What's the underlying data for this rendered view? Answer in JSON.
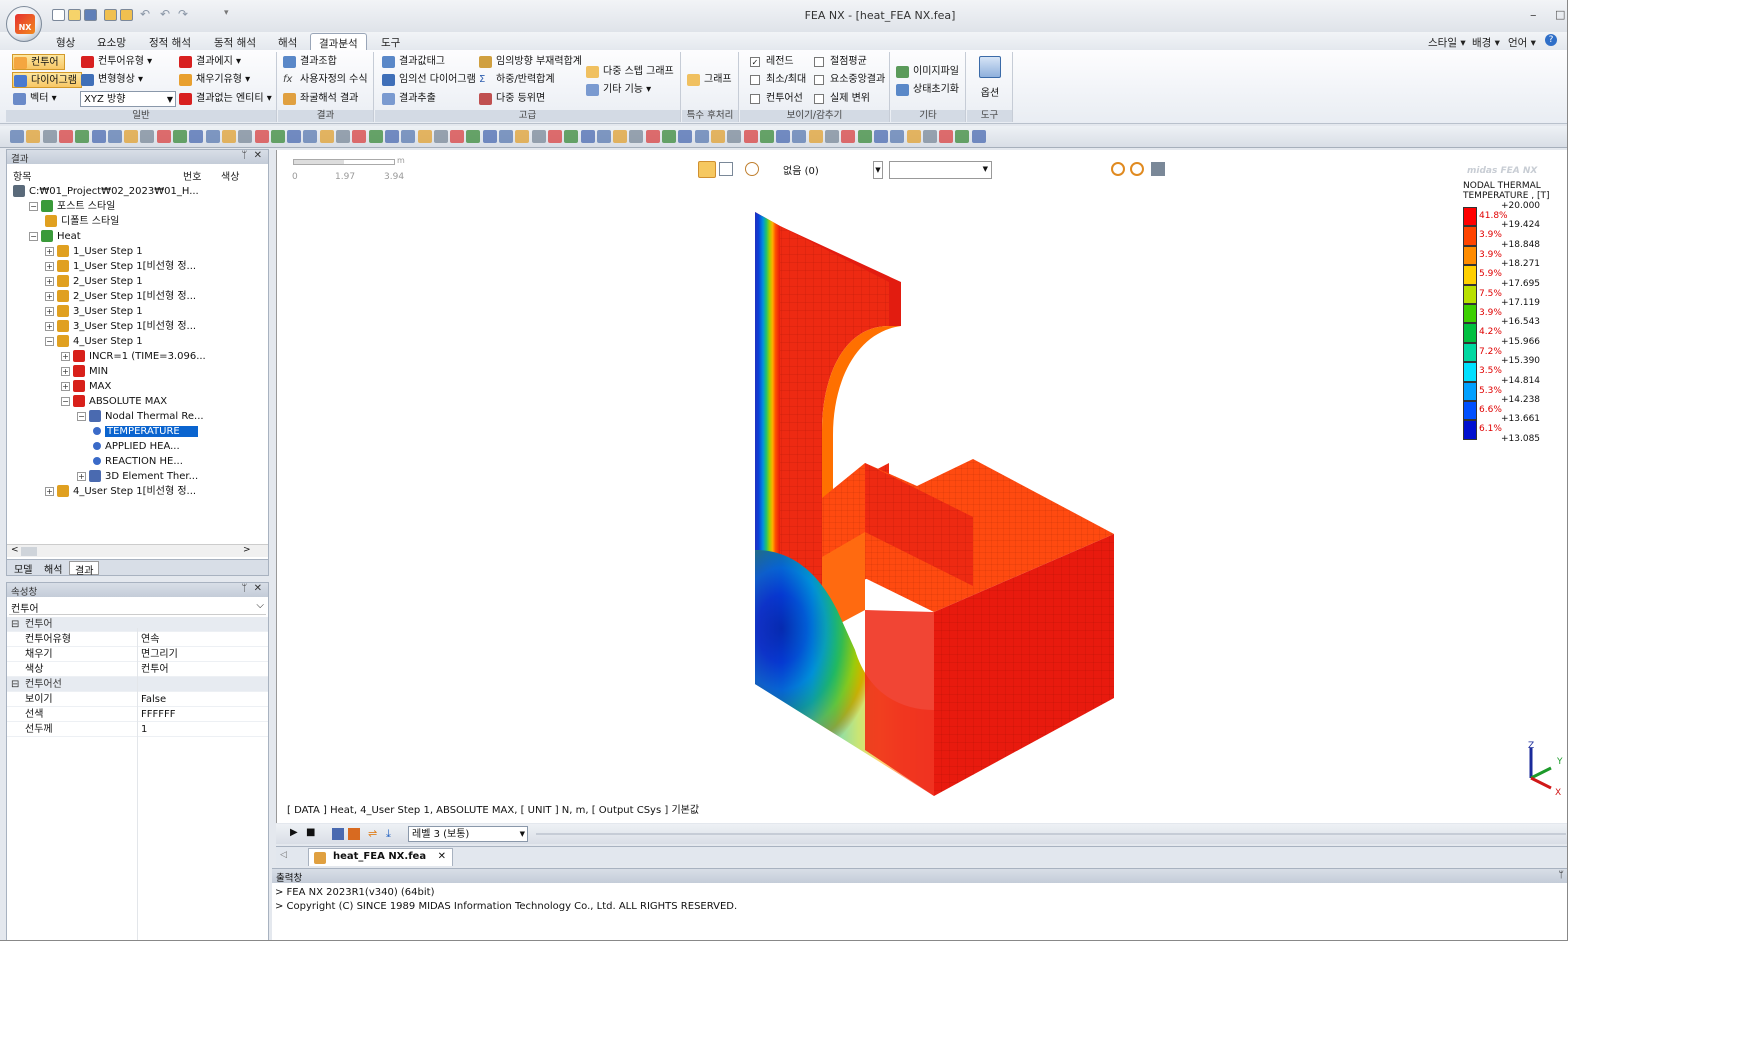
{
  "window": {
    "title": "FEA NX - [heat_FEA NX.fea]",
    "logo_text": "NX"
  },
  "menu": {
    "tabs": [
      "형상",
      "요소망",
      "정적 해석",
      "동적 해석",
      "해석",
      "결과분석",
      "도구"
    ],
    "right": [
      "스타일",
      "배경",
      "언어"
    ]
  },
  "ribbon": {
    "general": {
      "label": "일반",
      "contour": "컨투어",
      "contour_type": "컨투어유형",
      "result_edge": "결과에지",
      "diagram": "다이어그램",
      "deform": "변형형상",
      "fill_type": "채우기유형",
      "vector": "벡터",
      "direction": "XYZ 방향",
      "no_result_entity": "결과없는 엔티티"
    },
    "result": {
      "label": "결과",
      "combo": "결과조합",
      "custom_formula": "사용자정의 수식",
      "coord_result": "좌굴해석 결과"
    },
    "advanced": {
      "label": "고급",
      "result_tag": "결과값태그",
      "any_dir_member": "임의방향 부재력합계",
      "any_line_diagram": "임의선 다이어그램",
      "load_reaction_sum": "하중/반력합계",
      "result_extract": "결과추출",
      "multi_iso": "다중 등위면",
      "multi_step_graph": "다중 스텝 그래프",
      "etc": "기타 기능"
    },
    "special": {
      "label": "특수 후처리",
      "graph": "그래프"
    },
    "show": {
      "label": "보이기/감추기",
      "legend": "레전드",
      "minmax": "최소/최대",
      "contour_line": "컨투어선",
      "node_avg": "절점평균",
      "elem_center": "요소중앙결과",
      "real_disp": "실제 변위"
    },
    "etc": {
      "label": "기타",
      "image_file": "이미지파일",
      "state_reset": "상태초기화"
    },
    "tools": {
      "label": "도구",
      "options": "옵션"
    }
  },
  "results_panel": {
    "title": "결과",
    "col_item": "항목",
    "col_num": "번호",
    "col_color": "색상",
    "tree": [
      {
        "label": "C:₩01_Project₩02_2023₩01_H...",
        "lvl": 0,
        "ex": ""
      },
      {
        "label": "포스트 스타일",
        "lvl": 1,
        "ex": "−"
      },
      {
        "label": "디폴트 스타일",
        "lvl": 2,
        "ex": ""
      },
      {
        "label": "Heat",
        "lvl": 1,
        "ex": "−"
      },
      {
        "label": "1_User Step 1",
        "lvl": 2,
        "ex": "+"
      },
      {
        "label": "1_User Step 1[비선형 정...",
        "lvl": 2,
        "ex": "+"
      },
      {
        "label": "2_User Step 1",
        "lvl": 2,
        "ex": "+"
      },
      {
        "label": "2_User Step 1[비선형 정...",
        "lvl": 2,
        "ex": "+"
      },
      {
        "label": "3_User Step 1",
        "lvl": 2,
        "ex": "+"
      },
      {
        "label": "3_User Step 1[비선형 정...",
        "lvl": 2,
        "ex": "+"
      },
      {
        "label": "4_User Step 1",
        "lvl": 2,
        "ex": "−"
      },
      {
        "label": "INCR=1 (TIME=3.096...",
        "lvl": 3,
        "ex": "+"
      },
      {
        "label": "MIN",
        "lvl": 3,
        "ex": "+"
      },
      {
        "label": "MAX",
        "lvl": 3,
        "ex": "+"
      },
      {
        "label": "ABSOLUTE MAX",
        "lvl": 3,
        "ex": "−"
      },
      {
        "label": "Nodal Thermal Re...",
        "lvl": 4,
        "ex": "−"
      },
      {
        "label": "TEMPERATURE",
        "lvl": 5,
        "ex": "",
        "sel": true
      },
      {
        "label": "APPLIED HEA...",
        "lvl": 5,
        "ex": ""
      },
      {
        "label": "REACTION HE...",
        "lvl": 5,
        "ex": ""
      },
      {
        "label": "3D Element Ther...",
        "lvl": 4,
        "ex": "+"
      },
      {
        "label": "4_User Step 1[비선형 정...",
        "lvl": 2,
        "ex": "+"
      }
    ],
    "tabs": [
      "모델",
      "해석",
      "결과"
    ]
  },
  "properties": {
    "title": "속성창",
    "selector": "컨투어",
    "rows": [
      {
        "k": "컨투어",
        "v": "",
        "grp": true
      },
      {
        "k": "컨투어유형",
        "v": "연속"
      },
      {
        "k": "채우기",
        "v": "면그리기"
      },
      {
        "k": "색상",
        "v": "컨투어"
      },
      {
        "k": "컨투어선",
        "v": "",
        "grp": true
      },
      {
        "k": "보이기",
        "v": "False"
      },
      {
        "k": "선색",
        "v": "FFFFFF"
      },
      {
        "k": "선두께",
        "v": "1"
      }
    ]
  },
  "viewport": {
    "scale": {
      "unit": "m",
      "ticks": [
        "0",
        "1.97",
        "3.94"
      ]
    },
    "toolbar_select": "없음 (0)",
    "info_line": "[ DATA ] Heat, 4_User Step 1, ABSOLUTE MAX, [ UNIT ] N, m, [ Output CSys ] 기본값",
    "watermark": "midas FEA NX",
    "legend": {
      "title1": "NODAL THERMAL",
      "title2": "TEMPERATURE , [T]",
      "values": [
        "+20.000",
        "+19.424",
        "+18.848",
        "+18.271",
        "+17.695",
        "+17.119",
        "+16.543",
        "+15.966",
        "+15.390",
        "+14.814",
        "+14.238",
        "+13.661",
        "+13.085"
      ],
      "percents": [
        "41.8%",
        "3.9%",
        "3.9%",
        "5.9%",
        "7.5%",
        "3.9%",
        "4.2%",
        "7.2%",
        "3.5%",
        "5.3%",
        "6.6%",
        "6.1%"
      ],
      "colors": [
        "#ff0000",
        "#ff4400",
        "#ff8c00",
        "#ffd000",
        "#b8e000",
        "#3cd000",
        "#00c040",
        "#00d8a0",
        "#00e0ff",
        "#00a0ff",
        "#0050ff",
        "#0010d0"
      ]
    },
    "axes": {
      "x": "X",
      "y": "Y",
      "z": "Z"
    }
  },
  "bottom": {
    "level": "레벨 3 (보통)",
    "doc_tab": "heat_FEA NX.fea"
  },
  "output": {
    "title": "출력창",
    "lines": [
      "> FEA NX 2023R1(v340) (64bit)",
      "> Copyright (C) SINCE 1989 MIDAS Information Technology Co., Ltd. ALL RIGHTS RESERVED."
    ]
  }
}
